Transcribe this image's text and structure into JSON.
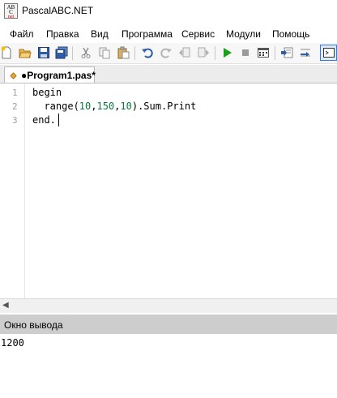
{
  "window": {
    "title": "PascalABC.NET",
    "icon_letters": [
      "AB",
      "C",
      "net"
    ]
  },
  "menu": [
    "Файл",
    "Правка",
    "Вид",
    "Программа",
    "Сервис",
    "Модули",
    "Помощь"
  ],
  "toolbar": {
    "icons": [
      "new-file-icon",
      "open-icon",
      "save-icon",
      "save-all-icon",
      "cut-icon",
      "copy-icon",
      "paste-icon",
      "undo-icon",
      "redo-icon",
      "navigate-back-icon",
      "navigate-forward-icon",
      "run-icon",
      "stop-icon",
      "compile-icon",
      "step-in-icon",
      "step-over-icon",
      "output-window-icon"
    ]
  },
  "tab": {
    "label": "●Program1.pas*"
  },
  "editor": {
    "line_numbers": [
      "1",
      "2",
      "3"
    ],
    "line1": "begin",
    "line2": {
      "pre": "  range(",
      "n1": "10",
      "c1": ",",
      "n2": "150",
      "c2": ",",
      "n3": "10",
      "post": ").Sum.Print"
    },
    "line3": "end."
  },
  "output": {
    "title": "Окно вывода",
    "text": "1200"
  },
  "colors": {
    "number": "#0a7a3a",
    "run_green": "#1aa01a",
    "output_header": "#cdcdcd"
  }
}
